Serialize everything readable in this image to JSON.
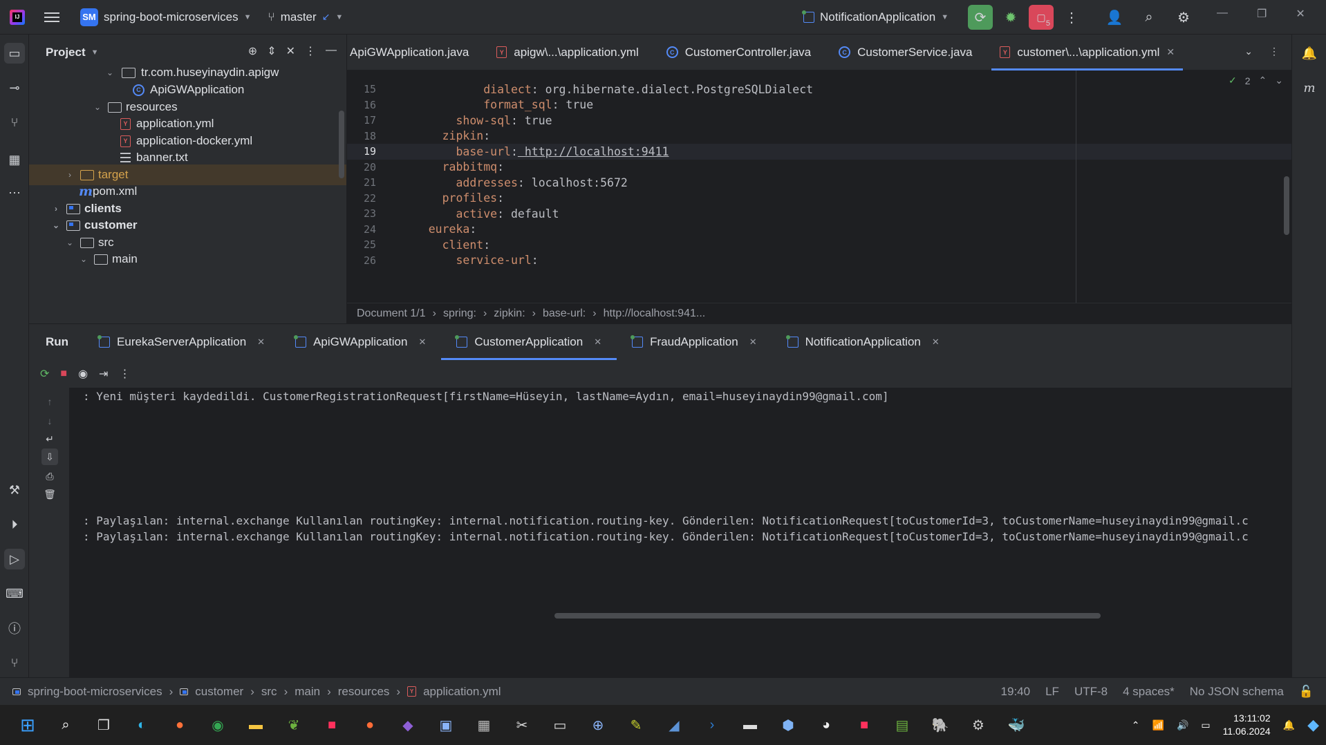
{
  "topbar": {
    "project_badge": "SM",
    "project_name": "spring-boot-microservices",
    "branch": "master",
    "run_config": "NotificationApplication",
    "stop_count": "5"
  },
  "project_panel": {
    "title": "Project",
    "tree": [
      {
        "label": "tr.com.huseyinaydin.apigw",
        "kind": "package"
      },
      {
        "label": "ApiGWApplication",
        "kind": "class"
      },
      {
        "label": "resources",
        "kind": "folder"
      },
      {
        "label": "application.yml",
        "kind": "yml"
      },
      {
        "label": "application-docker.yml",
        "kind": "yml"
      },
      {
        "label": "banner.txt",
        "kind": "txt"
      },
      {
        "label": "target",
        "kind": "target"
      },
      {
        "label": "pom.xml",
        "kind": "maven"
      },
      {
        "label": "clients",
        "kind": "module"
      },
      {
        "label": "customer",
        "kind": "module"
      },
      {
        "label": "src",
        "kind": "folder"
      },
      {
        "label": "main",
        "kind": "folder"
      }
    ]
  },
  "editor": {
    "tabs": [
      {
        "label": "ApiGWApplication.java",
        "icon": "class-icon"
      },
      {
        "label": "apigw\\...\\application.yml",
        "icon": "yml-icon"
      },
      {
        "label": "CustomerController.java",
        "icon": "class-icon"
      },
      {
        "label": "CustomerService.java",
        "icon": "class-icon"
      },
      {
        "label": "customer\\...\\application.yml",
        "icon": "yml-icon"
      }
    ],
    "problems_count": "2",
    "lines": [
      {
        "n": "15",
        "indent": "        ",
        "key": "dialect",
        "value": " org.hibernate.dialect.PostgreSQLDialect"
      },
      {
        "n": "16",
        "indent": "        ",
        "key": "format_sql",
        "value": " true"
      },
      {
        "n": "17",
        "indent": "    ",
        "key": "show-sql",
        "value": " true"
      },
      {
        "n": "18",
        "indent": "  ",
        "key": "zipkin",
        "value": ""
      },
      {
        "n": "19",
        "indent": "    ",
        "key": "base-url",
        "value": " http://localhost:9411"
      },
      {
        "n": "20",
        "indent": "  ",
        "key": "rabbitmq",
        "value": ""
      },
      {
        "n": "21",
        "indent": "    ",
        "key": "addresses",
        "value": " localhost:5672"
      },
      {
        "n": "22",
        "indent": "  ",
        "key": "profiles",
        "value": ""
      },
      {
        "n": "23",
        "indent": "    ",
        "key": "active",
        "value": " default"
      },
      {
        "n": "24",
        "indent": "",
        "key": "eureka",
        "value": ""
      },
      {
        "n": "25",
        "indent": "  ",
        "key": "client",
        "value": ""
      },
      {
        "n": "26",
        "indent": "    ",
        "key": "service-url",
        "value": ""
      }
    ],
    "breadcrumb": [
      "Document 1/1",
      "spring:",
      "zipkin:",
      "base-url:",
      "http://localhost:941..."
    ]
  },
  "run_panel": {
    "title": "Run",
    "tabs": [
      "EurekaServerApplication",
      "ApiGWApplication",
      "CustomerApplication",
      "FraudApplication",
      "NotificationApplication"
    ],
    "active_tab": "CustomerApplication",
    "console": [
      ": Yeni müşteri kaydedildi. CustomerRegistrationRequest[firstName=Hüseyin, lastName=Aydın, email=huseyinaydin99@gmail.com]",
      ": Paylaşılan: internal.exchange Kullanılan routingKey: internal.notification.routing-key. Gönderilen: NotificationRequest[toCustomerId=3, toCustomerName=huseyinaydin99@gmail.c",
      ": Paylaşılan: internal.exchange Kullanılan routingKey: internal.notification.routing-key. Gönderilen: NotificationRequest[toCustomerId=3, toCustomerName=huseyinaydin99@gmail.c"
    ]
  },
  "statusbar": {
    "crumbs": [
      "spring-boot-microservices",
      "customer",
      "src",
      "main",
      "resources",
      "application.yml"
    ],
    "position": "19:40",
    "line_sep": "LF",
    "encoding": "UTF-8",
    "indent": "4 spaces*",
    "schema": "No JSON schema"
  },
  "taskbar": {
    "time": "13:11:02",
    "date": "11.06.2024"
  }
}
